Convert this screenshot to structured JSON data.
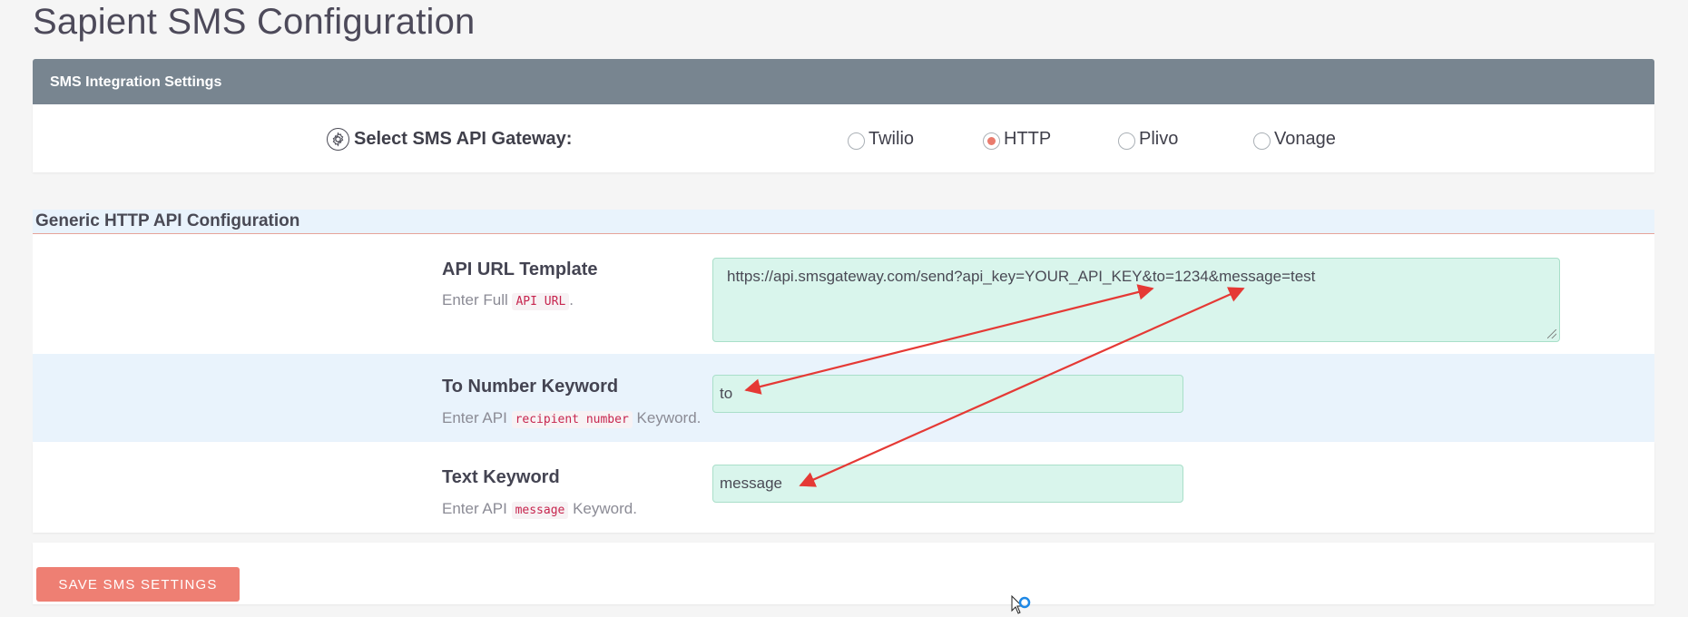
{
  "page": {
    "title": "Sapient SMS Configuration"
  },
  "integration": {
    "header": "SMS Integration Settings",
    "gateway_label": "Select SMS API Gateway:",
    "gateway_icon": "gear-icon",
    "options": [
      {
        "label": "Twilio",
        "checked": false
      },
      {
        "label": "HTTP",
        "checked": true
      },
      {
        "label": "Plivo",
        "checked": false
      },
      {
        "label": "Vonage",
        "checked": false
      }
    ],
    "accent_color": "#e97b6d"
  },
  "http_config": {
    "heading": "Generic HTTP API Configuration",
    "fields": [
      {
        "label": "API URL Template",
        "help_prefix": "Enter Full",
        "help_code": "API URL",
        "help_suffix": ".",
        "value": "https://api.smsgateway.com/send?api_key=YOUR_API_KEY&to=1234&message=test"
      },
      {
        "label": "To Number Keyword",
        "help_prefix": "Enter API",
        "help_code": "recipient number",
        "help_suffix": "Keyword.",
        "value": "to"
      },
      {
        "label": "Text Keyword",
        "help_prefix": "Enter API",
        "help_code": "message",
        "help_suffix": "Keyword.",
        "value": "message"
      }
    ]
  },
  "footer": {
    "save_label": "SAVE SMS SETTINGS",
    "save_color": "#ee7f73"
  },
  "annotations": {
    "arrow_color": "#e53935"
  }
}
